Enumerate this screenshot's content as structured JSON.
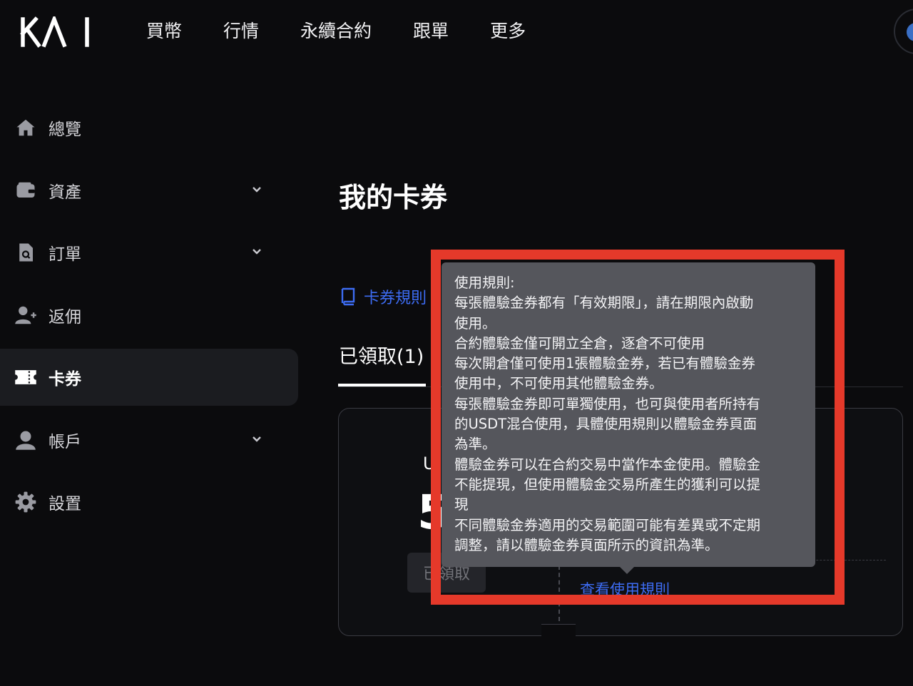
{
  "header": {
    "logo_text": "KAI",
    "nav": [
      "買幣",
      "行情",
      "永續合約",
      "跟單",
      "更多"
    ]
  },
  "sidebar": {
    "items": [
      {
        "label": "總覽",
        "icon": "home-icon",
        "has_chevron": false
      },
      {
        "label": "資產",
        "icon": "wallet-icon",
        "has_chevron": true
      },
      {
        "label": "訂單",
        "icon": "order-icon",
        "has_chevron": true
      },
      {
        "label": "返佣",
        "icon": "add-user-icon",
        "has_chevron": false
      },
      {
        "label": "卡券",
        "icon": "ticket-icon",
        "has_chevron": false,
        "active": true
      },
      {
        "label": "帳戶",
        "icon": "user-icon",
        "has_chevron": true
      },
      {
        "label": "設置",
        "icon": "gear-icon",
        "has_chevron": false
      }
    ]
  },
  "main": {
    "title": "我的卡券",
    "rules_link": "卡券規則",
    "tab_claimed": "已領取(1)",
    "coupon": {
      "type_partial": "U",
      "amount_partial": "5",
      "claimed_label": "已領取",
      "view_rules": "查看使用規則"
    }
  },
  "tooltip": {
    "lines": [
      "使用規則:",
      "每張體驗金券都有「有效期限」，請在期限內啟動",
      "使用。",
      "合約體驗金僅可開立全倉，逐倉不可使用",
      "每次開倉僅可使用1張體驗金券，若已有體驗金券",
      "使用中，不可使用其他體驗金券。",
      "每張體驗金券即可單獨使用，也可與使用者所持有",
      "的USDT混合使用，具體使用規則以體驗金券頁面",
      "為準。",
      "體驗金券可以在合約交易中當作本金使用。體驗金",
      "不能提現，但使用體驗金交易所產生的獲利可以提",
      "現",
      "不同體驗金券適用的交易範圍可能有差異或不定期",
      "調整，請以體驗金券頁面所示的資訊為準。"
    ]
  },
  "colors": {
    "background": "#0b0b0d",
    "accent_blue": "#3d6cf3",
    "highlight_red": "#e5392a",
    "tooltip_bg": "#55565c"
  }
}
